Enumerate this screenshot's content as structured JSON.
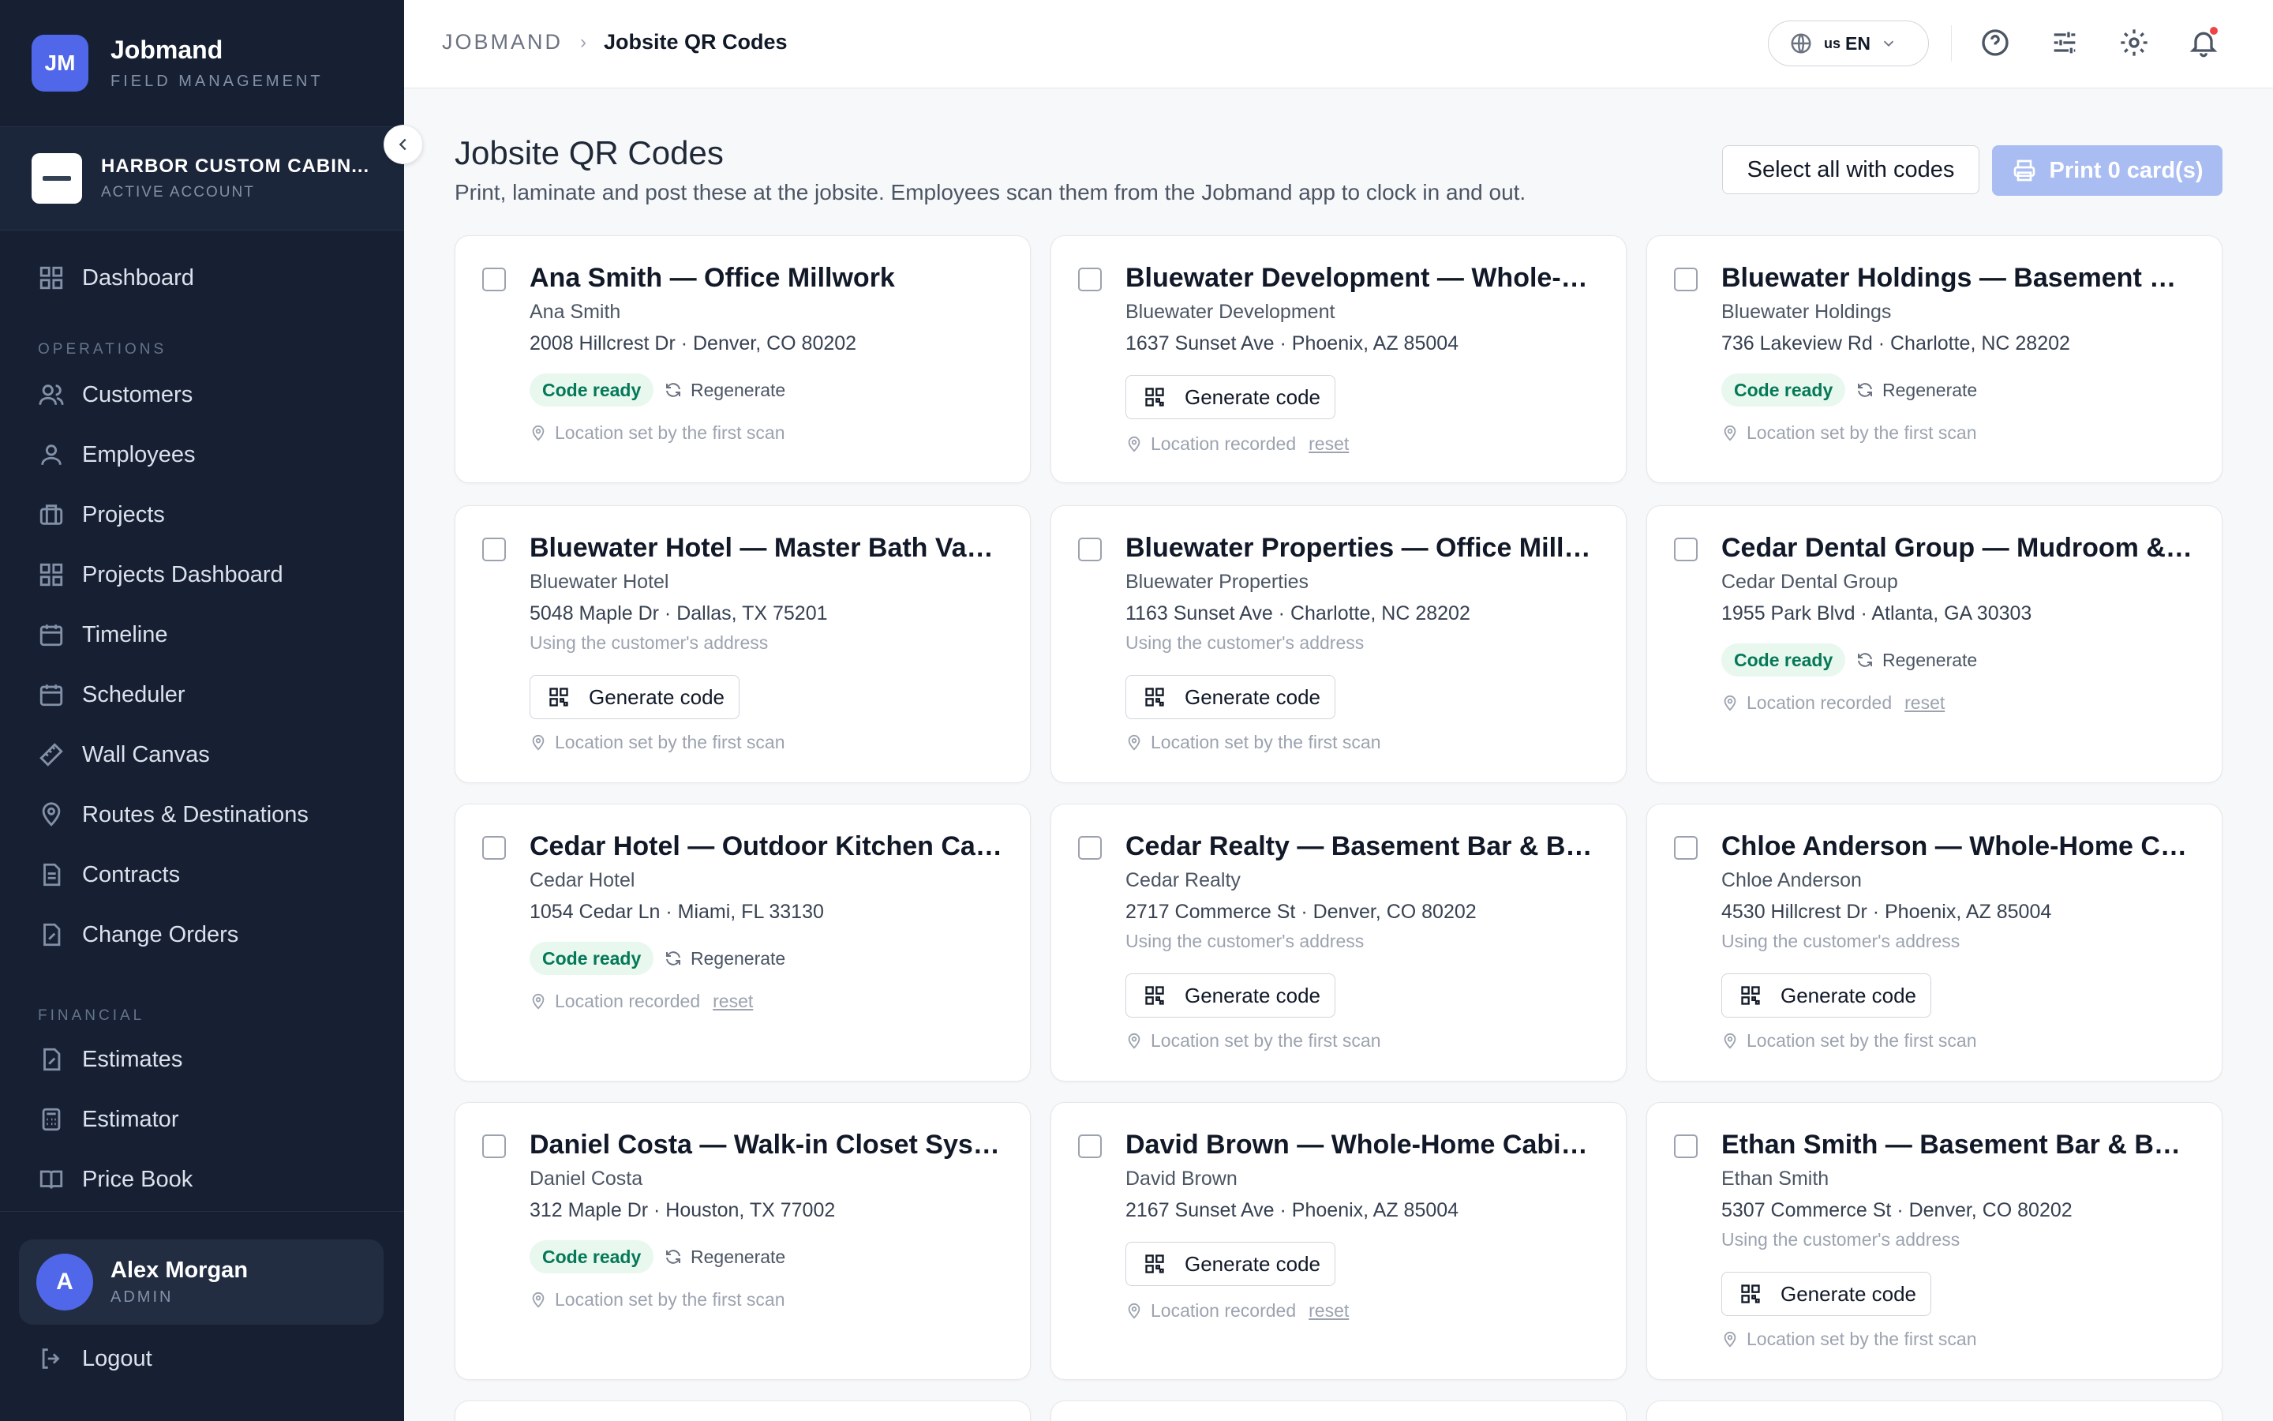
{
  "brand": {
    "initials": "JM",
    "name": "Jobmand",
    "subtitle": "FIELD MANAGEMENT"
  },
  "account": {
    "name": "HARBOR CUSTOM CABIN...",
    "status": "ACTIVE ACCOUNT"
  },
  "nav": {
    "dashboard": "Dashboard",
    "operations_heading": "OPERATIONS",
    "customers": "Customers",
    "employees": "Employees",
    "projects": "Projects",
    "projects_dashboard": "Projects Dashboard",
    "timeline": "Timeline",
    "scheduler": "Scheduler",
    "wall_canvas": "Wall Canvas",
    "routes": "Routes & Destinations",
    "contracts": "Contracts",
    "change_orders": "Change Orders",
    "financial_heading": "FINANCIAL",
    "estimates": "Estimates",
    "estimator": "Estimator",
    "price_book": "Price Book"
  },
  "user": {
    "initial": "A",
    "name": "Alex Morgan",
    "role": "ADMIN"
  },
  "logout": "Logout",
  "breadcrumb": {
    "root": "JOBMAND",
    "current": "Jobsite QR Codes"
  },
  "language": {
    "flag": "us",
    "code": "EN"
  },
  "page": {
    "title": "Jobsite QR Codes",
    "subtitle": "Print, laminate and post these at the jobsite. Employees scan them from the Jobmand app to clock in and out.",
    "select_all": "Select all with codes",
    "print": "Print 0 card(s)"
  },
  "labels": {
    "code_ready": "Code ready",
    "regenerate": "Regenerate",
    "generate": "Generate code",
    "reset": "reset"
  },
  "cards": [
    {
      "title": "Ana Smith — Office Millwork",
      "customer": "Ana Smith",
      "address": "2008 Hillcrest Dr · Denver, CO 80202",
      "note": "",
      "location": "Location set by the first scan"
    },
    {
      "title": "Bluewater Development — Whole-H...",
      "customer": "Bluewater Development",
      "address": "1637 Sunset Ave · Phoenix, AZ 85004",
      "note": "",
      "location": "Location recorded"
    },
    {
      "title": "Bluewater Holdings — Basement Bar...",
      "customer": "Bluewater Holdings",
      "address": "736 Lakeview Rd · Charlotte, NC 28202",
      "note": "",
      "location": "Location set by the first scan"
    },
    {
      "title": "Bluewater Hotel — Master Bath Vani...",
      "customer": "Bluewater Hotel",
      "address": "5048 Maple Dr · Dallas, TX 75201",
      "note": "Using the customer's address",
      "location": "Location set by the first scan"
    },
    {
      "title": "Bluewater Properties — Office Millw...",
      "customer": "Bluewater Properties",
      "address": "1163 Sunset Ave · Charlotte, NC 28202",
      "note": "Using the customer's address",
      "location": "Location set by the first scan"
    },
    {
      "title": "Cedar Dental Group — Mudroom & L...",
      "customer": "Cedar Dental Group",
      "address": "1955 Park Blvd · Atlanta, GA 30303",
      "note": "",
      "location": "Location recorded"
    },
    {
      "title": "Cedar Hotel — Outdoor Kitchen Cabi...",
      "customer": "Cedar Hotel",
      "address": "1054 Cedar Ln · Miami, FL 33130",
      "note": "",
      "location": "Location recorded"
    },
    {
      "title": "Cedar Realty — Basement Bar & Buil...",
      "customer": "Cedar Realty",
      "address": "2717 Commerce St · Denver, CO 80202",
      "note": "Using the customer's address",
      "location": "Location set by the first scan"
    },
    {
      "title": "Chloe Anderson — Whole-Home Ca...",
      "customer": "Chloe Anderson",
      "address": "4530 Hillcrest Dr · Phoenix, AZ 85004",
      "note": "Using the customer's address",
      "location": "Location set by the first scan"
    },
    {
      "title": "Daniel Costa — Walk-in Closet System",
      "customer": "Daniel Costa",
      "address": "312 Maple Dr · Houston, TX 77002",
      "note": "",
      "location": "Location set by the first scan"
    },
    {
      "title": "David Brown — Whole-Home Cabine...",
      "customer": "David Brown",
      "address": "2167 Sunset Ave · Phoenix, AZ 85004",
      "note": "",
      "location": "Location recorded"
    },
    {
      "title": "Ethan Smith — Basement Bar & Built...",
      "customer": "Ethan Smith",
      "address": "5307 Commerce St · Denver, CO 80202",
      "note": "Using the customer's address",
      "location": "Location set by the first scan"
    }
  ]
}
